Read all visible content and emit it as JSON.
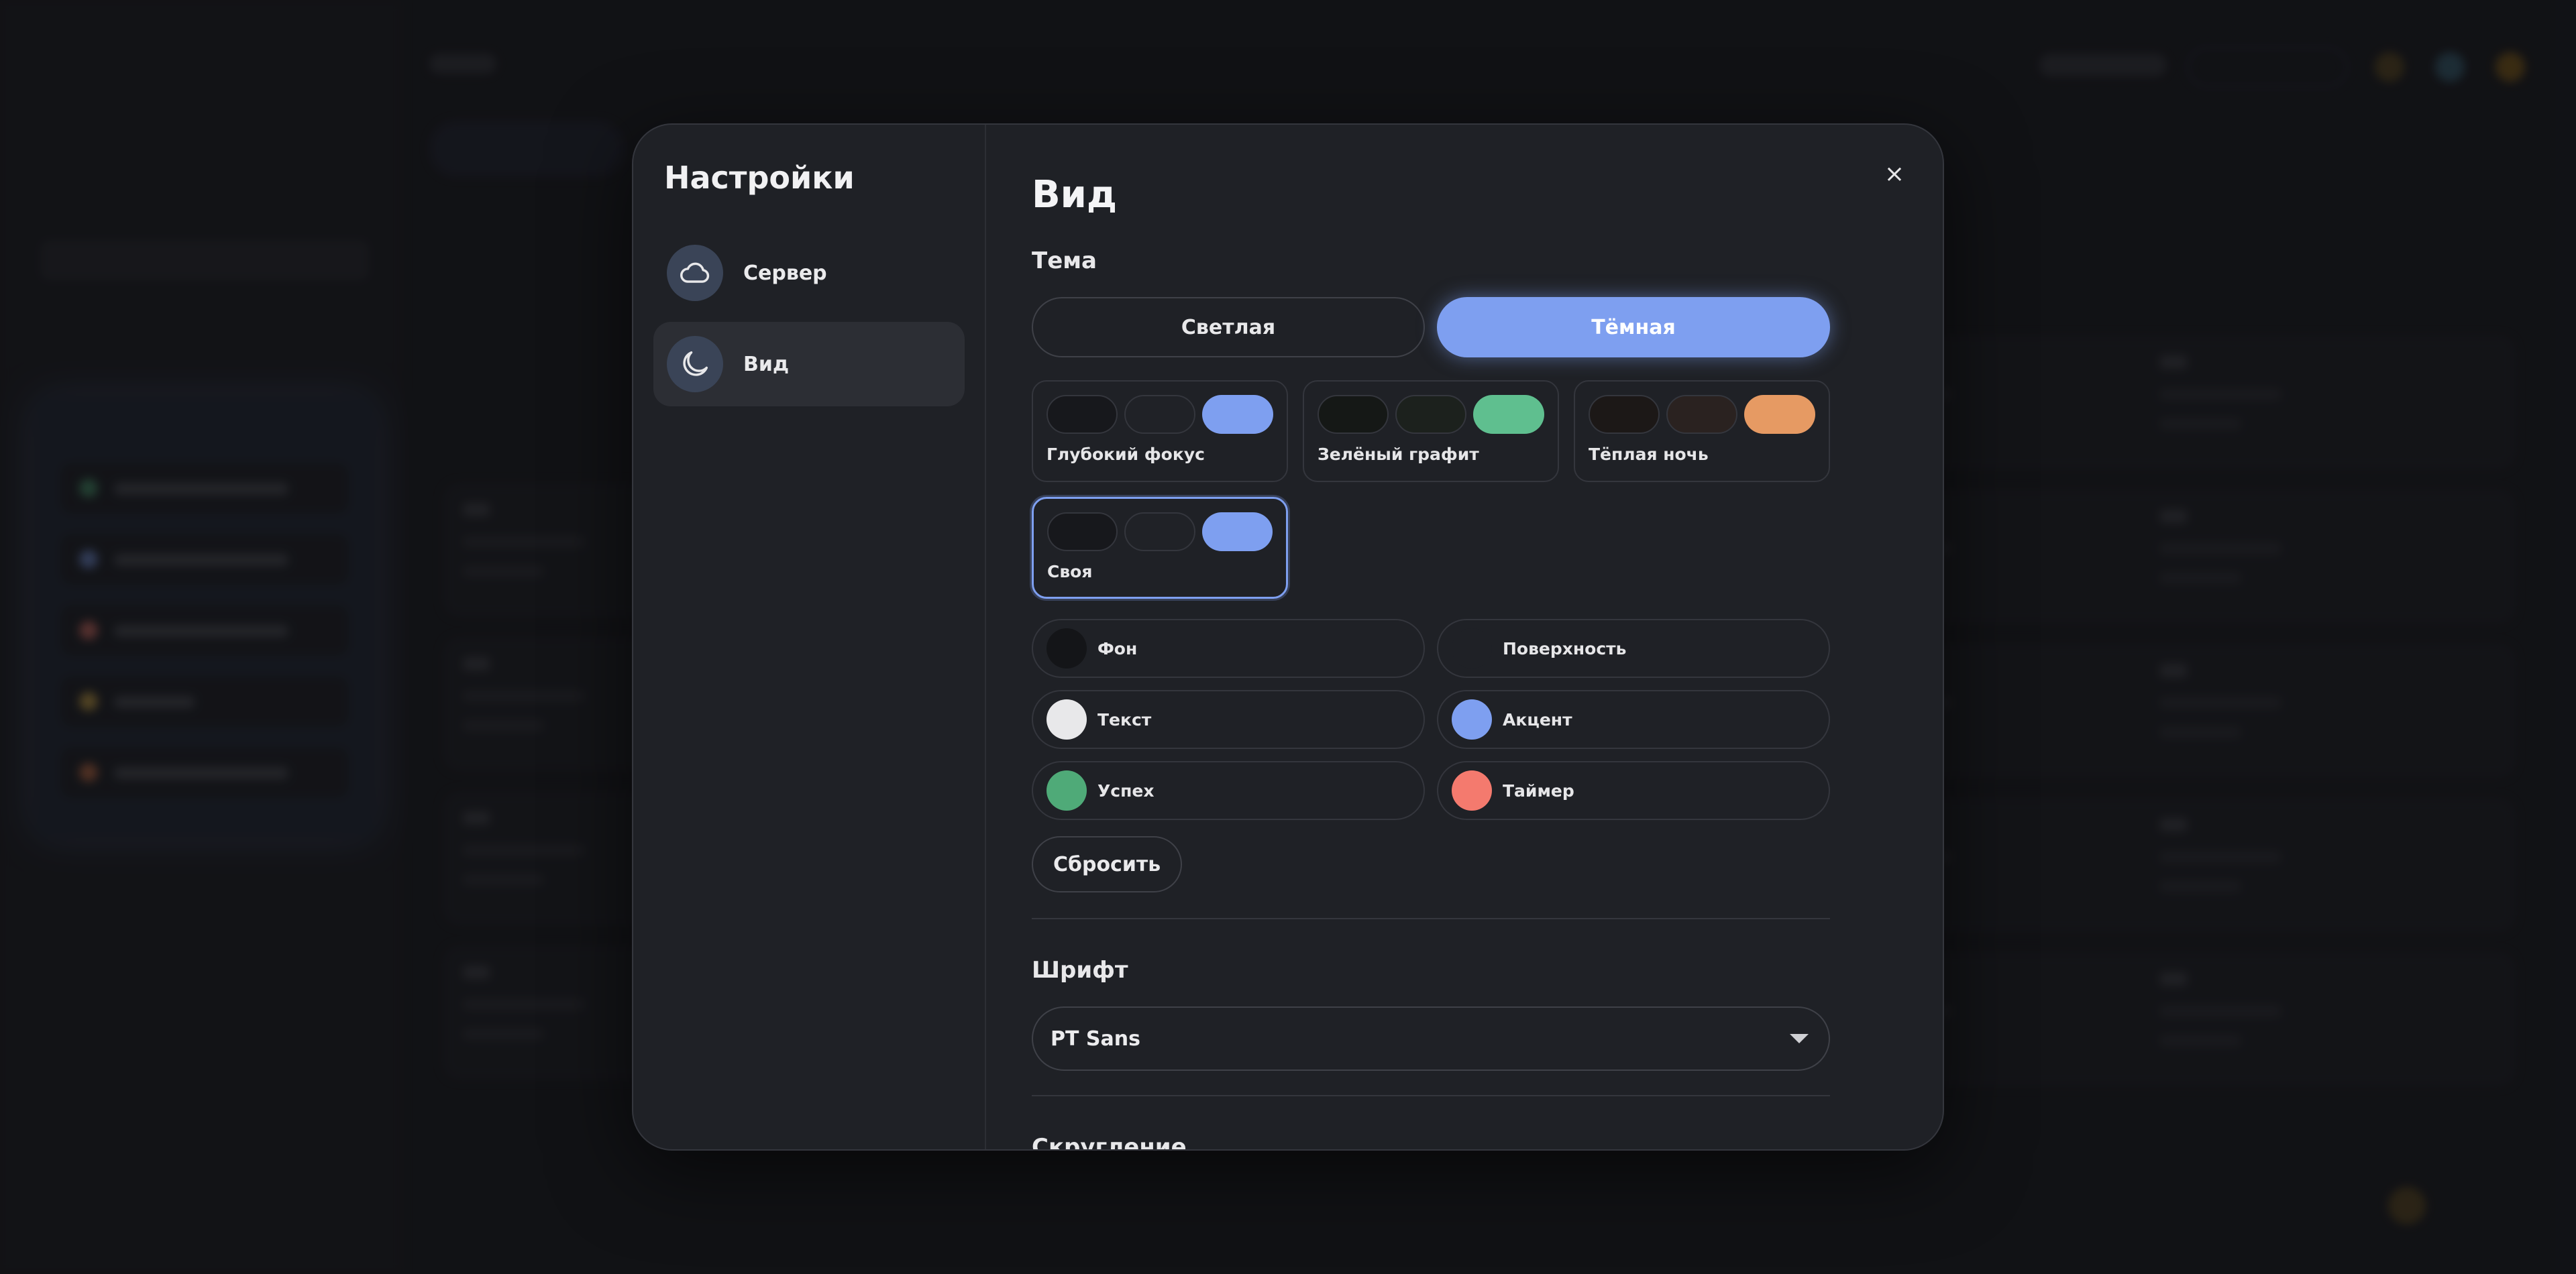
{
  "settings": {
    "title": "Настройки",
    "nav": [
      {
        "label": "Сервер",
        "icon": "cloud-icon"
      },
      {
        "label": "Вид",
        "icon": "moon-icon",
        "active": true
      }
    ],
    "close_label": "×"
  },
  "appearance": {
    "page_title": "Вид",
    "theme_heading": "Тема",
    "modes": [
      {
        "label": "Светлая",
        "active": false
      },
      {
        "label": "Тёмная",
        "active": true
      }
    ],
    "presets": [
      {
        "name": "Глубокий фокус",
        "colors": [
          "#17181c",
          "#202227",
          "#7e9ff0"
        ]
      },
      {
        "name": "Зелёный графит",
        "colors": [
          "#151816",
          "#1c211d",
          "#5fbf8f"
        ]
      },
      {
        "name": "Тёплая ночь",
        "colors": [
          "#1c1817",
          "#2a2220",
          "#e69a63"
        ]
      },
      {
        "name": "Своя",
        "colors": [
          "#17181c",
          "#202227",
          "#7e9ff0"
        ],
        "selected": true
      }
    ],
    "colors": [
      {
        "label": "Фон",
        "value": "#141518"
      },
      {
        "label": "Поверхность",
        "value": "#1f2126"
      },
      {
        "label": "Текст",
        "value": "#e8e8ea"
      },
      {
        "label": "Акцент",
        "value": "#7e9ff0"
      },
      {
        "label": "Успех",
        "value": "#4faa78"
      },
      {
        "label": "Таймер",
        "value": "#f47a6e"
      }
    ],
    "reset_label": "Сбросить",
    "font_heading": "Шрифт",
    "font_value": "PT Sans",
    "rounding_heading": "Скругление"
  }
}
